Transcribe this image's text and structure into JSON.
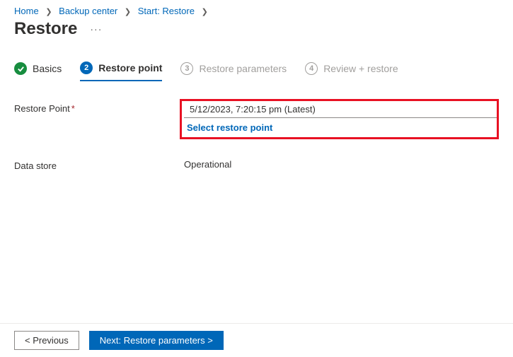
{
  "breadcrumb": {
    "items": [
      {
        "label": "Home"
      },
      {
        "label": "Backup center"
      },
      {
        "label": "Start: Restore"
      }
    ]
  },
  "page": {
    "title": "Restore"
  },
  "tabs": {
    "basics": {
      "label": "Basics"
    },
    "restore_point": {
      "num": "2",
      "label": "Restore point"
    },
    "restore_params": {
      "num": "3",
      "label": "Restore parameters"
    },
    "review": {
      "num": "4",
      "label": "Review + restore"
    }
  },
  "form": {
    "restore_point_label": "Restore Point",
    "restore_point_value": "5/12/2023, 7:20:15 pm (Latest)",
    "select_link": "Select restore point",
    "data_store_label": "Data store",
    "data_store_value": "Operational"
  },
  "footer": {
    "previous": "< Previous",
    "next": "Next: Restore parameters >"
  }
}
